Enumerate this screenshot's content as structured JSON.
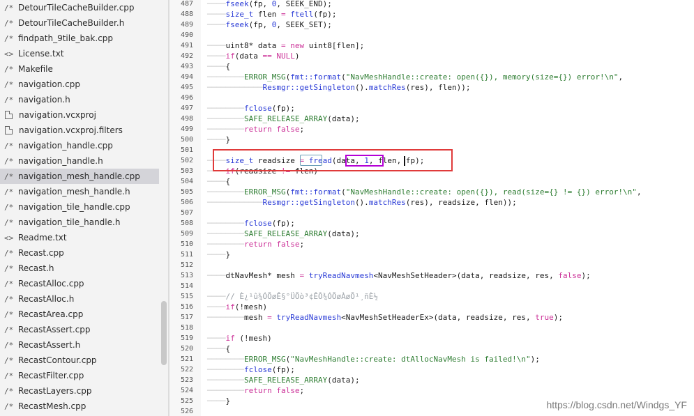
{
  "sidebar": {
    "files": [
      {
        "icon": "/*",
        "name": "DetourTileCacheBuilder.cpp"
      },
      {
        "icon": "/*",
        "name": "DetourTileCacheBuilder.h"
      },
      {
        "icon": "/*",
        "name": "findpath_9tile_bak.cpp"
      },
      {
        "icon": "<>",
        "name": "License.txt"
      },
      {
        "icon": "/*",
        "name": "Makefile"
      },
      {
        "icon": "/*",
        "name": "navigation.cpp"
      },
      {
        "icon": "/*",
        "name": "navigation.h"
      },
      {
        "icon": "doc",
        "name": "navigation.vcxproj"
      },
      {
        "icon": "doc",
        "name": "navigation.vcxproj.filters"
      },
      {
        "icon": "/*",
        "name": "navigation_handle.cpp"
      },
      {
        "icon": "/*",
        "name": "navigation_handle.h"
      },
      {
        "icon": "/*",
        "name": "navigation_mesh_handle.cpp",
        "selected": true
      },
      {
        "icon": "/*",
        "name": "navigation_mesh_handle.h"
      },
      {
        "icon": "/*",
        "name": "navigation_tile_handle.cpp"
      },
      {
        "icon": "/*",
        "name": "navigation_tile_handle.h"
      },
      {
        "icon": "<>",
        "name": "Readme.txt"
      },
      {
        "icon": "/*",
        "name": "Recast.cpp"
      },
      {
        "icon": "/*",
        "name": "Recast.h"
      },
      {
        "icon": "/*",
        "name": "RecastAlloc.cpp"
      },
      {
        "icon": "/*",
        "name": "RecastAlloc.h"
      },
      {
        "icon": "/*",
        "name": "RecastArea.cpp"
      },
      {
        "icon": "/*",
        "name": "RecastAssert.cpp"
      },
      {
        "icon": "/*",
        "name": "RecastAssert.h"
      },
      {
        "icon": "/*",
        "name": "RecastContour.cpp"
      },
      {
        "icon": "/*",
        "name": "RecastFilter.cpp"
      },
      {
        "icon": "/*",
        "name": "RecastLayers.cpp"
      },
      {
        "icon": "/*",
        "name": "RecastMesh.cpp"
      }
    ]
  },
  "editor": {
    "lines": [
      {
        "n": "487",
        "indent": "────",
        "html": "<span class=\"fn\">fseek</span>(fp, <span class=\"num\">0</span>, SEEK_END);"
      },
      {
        "n": "488",
        "indent": "────",
        "html": "<span class=\"ty\">size_t</span> flen <span class=\"op\">=</span> <span class=\"fn\">ftell</span>(fp);"
      },
      {
        "n": "489",
        "indent": "────",
        "html": "<span class=\"fn\">fseek</span>(fp, <span class=\"num\">0</span>, SEEK_SET);"
      },
      {
        "n": "490",
        "indent": "",
        "html": ""
      },
      {
        "n": "491",
        "indent": "────",
        "html": "uint8* data <span class=\"op\">=</span> <span class=\"kw\">new</span> uint8[flen];"
      },
      {
        "n": "492",
        "indent": "────",
        "html": "<span class=\"kw\">if</span>(data <span class=\"op\">==</span> <span class=\"kw\">NULL</span>)"
      },
      {
        "n": "493",
        "indent": "────",
        "html": "{"
      },
      {
        "n": "494",
        "indent": "────────",
        "html": "<span class=\"mac\">ERROR_MSG</span>(<span class=\"fn\">fmt::format</span>(<span class=\"str\">\"NavMeshHandle::create: open({}), memory(size={}) error!\\n\"</span>,"
      },
      {
        "n": "495",
        "indent": "────────────",
        "html": "<span class=\"fn\">Resmgr::getSingleton</span>().<span class=\"fn\">matchRes</span>(res), flen));"
      },
      {
        "n": "496",
        "indent": "",
        "html": ""
      },
      {
        "n": "497",
        "indent": "────────",
        "html": "<span class=\"fn\">fclose</span>(fp);"
      },
      {
        "n": "498",
        "indent": "────────",
        "html": "<span class=\"mac\">SAFE_RELEASE_ARRAY</span>(data);"
      },
      {
        "n": "499",
        "indent": "────────",
        "html": "<span class=\"kw\">return</span> <span class=\"kw\">false</span>;"
      },
      {
        "n": "500",
        "indent": "────",
        "html": "}"
      },
      {
        "n": "501",
        "indent": "",
        "html": ""
      },
      {
        "n": "502",
        "indent": "────",
        "html": "<span class=\"ty\">size_t</span> readsize <span class=\"op\">=</span> <span class=\"fn\">fread</span>(data, <span class=\"num\">1</span>, flen, fp);"
      },
      {
        "n": "503",
        "indent": "────",
        "html": "<span class=\"kw\">if</span>(readsize <span class=\"op\">!=</span> flen)"
      },
      {
        "n": "504",
        "indent": "────",
        "html": "{"
      },
      {
        "n": "505",
        "indent": "────────",
        "html": "<span class=\"mac\">ERROR_MSG</span>(<span class=\"fn\">fmt::format</span>(<span class=\"str\">\"NavMeshHandle::create: open({}), read(size={} != {}) error!\\n\"</span>,"
      },
      {
        "n": "506",
        "indent": "────────────",
        "html": "<span class=\"fn\">Resmgr::getSingleton</span>().<span class=\"fn\">matchRes</span>(res), readsize, flen));"
      },
      {
        "n": "507",
        "indent": "",
        "html": ""
      },
      {
        "n": "508",
        "indent": "────────",
        "html": "<span class=\"fn\">fclose</span>(fp);"
      },
      {
        "n": "509",
        "indent": "────────",
        "html": "<span class=\"mac\">SAFE_RELEASE_ARRAY</span>(data);"
      },
      {
        "n": "510",
        "indent": "────────",
        "html": "<span class=\"kw\">return</span> <span class=\"kw\">false</span>;"
      },
      {
        "n": "511",
        "indent": "────",
        "html": "}"
      },
      {
        "n": "512",
        "indent": "",
        "html": ""
      },
      {
        "n": "513",
        "indent": "────",
        "html": "dtNavMesh* mesh <span class=\"op\">=</span> <span class=\"fn\">tryReadNavmesh</span>&lt;NavMeshSetHeader&gt;(data, readsize, res, <span class=\"kw\">false</span>);"
      },
      {
        "n": "514",
        "indent": "",
        "html": ""
      },
      {
        "n": "515",
        "indent": "────",
        "html": "<span class=\"cm\">// È¿¹û¾ÓÕøÊ§°ÜÕò³¢ÊÔ¾ÓÕøÀøÕ¹¸ñÈ½</span>"
      },
      {
        "n": "516",
        "indent": "────",
        "html": "<span class=\"kw\">if</span>(!mesh)"
      },
      {
        "n": "517",
        "indent": "────────",
        "html": "mesh <span class=\"op\">=</span> <span class=\"fn\">tryReadNavmesh</span>&lt;NavMeshSetHeaderEx&gt;(data, readsize, res, <span class=\"kw\">true</span>);"
      },
      {
        "n": "518",
        "indent": "",
        "html": ""
      },
      {
        "n": "519",
        "indent": "────",
        "html": "<span class=\"kw\">if</span> (!mesh)"
      },
      {
        "n": "520",
        "indent": "────",
        "html": "{"
      },
      {
        "n": "521",
        "indent": "────────",
        "html": "<span class=\"mac\">ERROR_MSG</span>(<span class=\"str\">\"NavMeshHandle::create: dtAllocNavMesh is failed!\\n\"</span>);"
      },
      {
        "n": "522",
        "indent": "────────",
        "html": "<span class=\"fn\">fclose</span>(fp);"
      },
      {
        "n": "523",
        "indent": "────────",
        "html": "<span class=\"mac\">SAFE_RELEASE_ARRAY</span>(data);"
      },
      {
        "n": "524",
        "indent": "────────",
        "html": "<span class=\"kw\">return</span> <span class=\"kw\">false</span>;"
      },
      {
        "n": "525",
        "indent": "────",
        "html": "}"
      },
      {
        "n": "526",
        "indent": "",
        "html": ""
      }
    ]
  },
  "watermark": "https://blog.csdn.net/Windgs_YF"
}
